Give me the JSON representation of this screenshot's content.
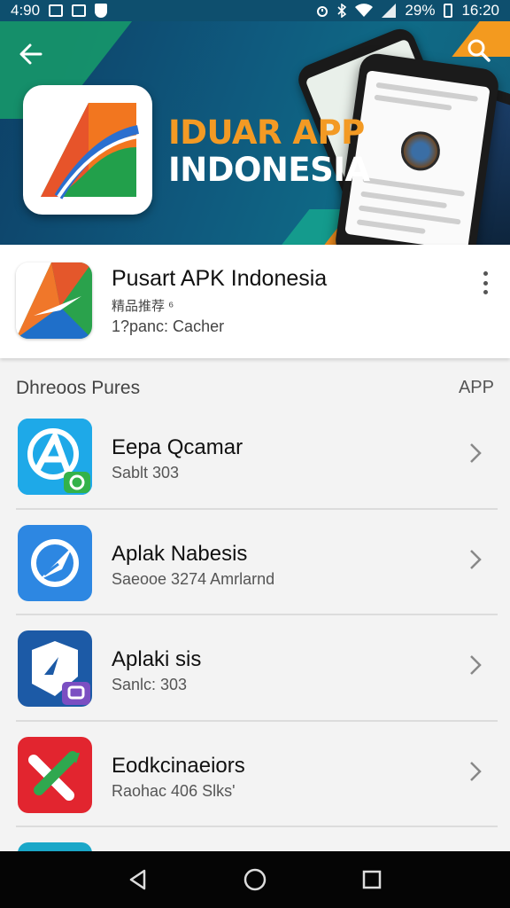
{
  "status_bar": {
    "time_left": "4:90",
    "battery": "29%",
    "time_right": "16:20"
  },
  "banner": {
    "title_line1": "IDUAR APP",
    "title_line2": "INDONESIA"
  },
  "featured": {
    "name": "Pusart APK Indonesia",
    "subtitle": "精品推荐 ⁶",
    "detail": "1?panc: Cacher"
  },
  "section": {
    "title": "Dhreoos Pures",
    "action": "APP"
  },
  "apps": [
    {
      "name": "Eepa Qcamar",
      "meta": "Sablt 303",
      "icon": "paper-plane-a-icon",
      "color": "#1aa7e6"
    },
    {
      "name": "Aplak Nabesis",
      "meta": "Saeooe 3274 Amrlarnd",
      "icon": "compass-arrow-icon",
      "color": "#2a86e0"
    },
    {
      "name": "Aplaki sis",
      "meta": "Sanlc: 303",
      "icon": "shield-box-icon",
      "color": "#1d5ca8"
    },
    {
      "name": "Eodkcinaeiors",
      "meta": "Raohac 406 Slks'",
      "icon": "cross-tools-icon",
      "color": "#e0252f"
    }
  ],
  "icons": {
    "back": "arrow-left-icon",
    "search": "search-icon",
    "more": "more-vertical-icon",
    "chevron": "chevron-right-icon",
    "nav_back": "triangle-back-icon",
    "nav_home": "circle-home-icon",
    "nav_recents": "square-recents-icon"
  },
  "colors": {
    "accent_orange": "#f39a24",
    "accent_green": "#16946a",
    "banner_blue": "#0f5a7e"
  }
}
